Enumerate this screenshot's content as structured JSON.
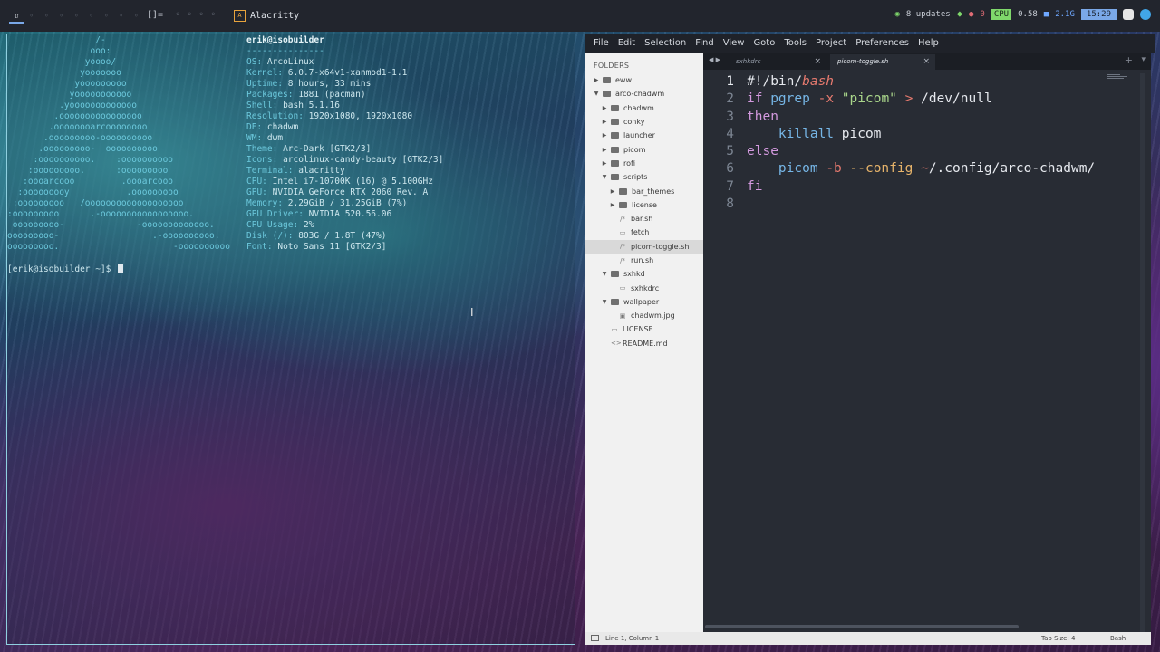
{
  "topbar": {
    "tags": [
      "ᴜ",
      "◦",
      "◦",
      "◦",
      "◦",
      "◦",
      "◦",
      "◦",
      "◦"
    ],
    "layout_symbol": "[]=",
    "layout_extras": [
      "◦",
      "◦",
      "◦",
      "◦"
    ],
    "window_icon": "A",
    "window_title": "Alacritty",
    "updates": "8 updates",
    "alerts": "0",
    "cpu_label": "CPU",
    "cpu_value": "0.58",
    "ram_value": "2.1G",
    "clock": "15:29"
  },
  "terminal": {
    "ascii_art": "                 /-\n                ooo:\n               yoooo/\n              yooooooo\n             yooooooooo\n            yooooooooooo\n          .yooooooooooooo\n         .oooooooooooooooo\n        .oooooooarcoooooooo\n       .ooooooooo-oooooooooo\n      .ooooooooo-  oooooooooo\n     :oooooooooo.    :oooooooooo\n    :ooooooooo.      :ooooooooo\n   :oooarcooo         .oooarcooo\n  :ooooooooy           .ooooooooo\n :ooooooooo   /ooooooooooooooooooo\n:ooooooooo      .-ooooooooooooooooo.\n ooooooooo-              -ooooooooooooo.\nooooooooo-                  .-oooooooooo.\nooooooooo.                      -oooooooooo",
    "user_host": "erik@isobuilder",
    "separator": "---------------",
    "info": [
      {
        "key": "OS",
        "value": "ArcoLinux"
      },
      {
        "key": "Kernel",
        "value": "6.0.7-x64v1-xanmod1-1.1"
      },
      {
        "key": "Uptime",
        "value": "8 hours, 33 mins"
      },
      {
        "key": "Packages",
        "value": "1881 (pacman)"
      },
      {
        "key": "Shell",
        "value": "bash 5.1.16"
      },
      {
        "key": "Resolution",
        "value": "1920x1080, 1920x1080"
      },
      {
        "key": "DE",
        "value": "chadwm"
      },
      {
        "key": "WM",
        "value": "dwm"
      },
      {
        "key": "Theme",
        "value": "Arc-Dark [GTK2/3]"
      },
      {
        "key": "Icons",
        "value": "arcolinux-candy-beauty [GTK2/3]"
      },
      {
        "key": "Terminal",
        "value": "alacritty"
      },
      {
        "key": "CPU",
        "value": "Intel i7-10700K (16) @ 5.100GHz"
      },
      {
        "key": "GPU",
        "value": "NVIDIA GeForce RTX 2060 Rev. A"
      },
      {
        "key": "Memory",
        "value": "2.29GiB / 31.25GiB (7%)"
      },
      {
        "key": "GPU Driver",
        "value": "NVIDIA 520.56.06"
      },
      {
        "key": "CPU Usage",
        "value": "2%"
      },
      {
        "key": "Disk (/)",
        "value": "803G / 1.8T (47%)"
      },
      {
        "key": "Font",
        "value": "Noto Sans 11 [GTK2/3]"
      }
    ],
    "prompt": "[erik@isobuilder ~]$ "
  },
  "editor": {
    "menu": [
      "File",
      "Edit",
      "Selection",
      "Find",
      "View",
      "Goto",
      "Tools",
      "Project",
      "Preferences",
      "Help"
    ],
    "folders_header": "FOLDERS",
    "tree": [
      {
        "label": "eww",
        "type": "folder",
        "depth": 0,
        "arrow": "▶"
      },
      {
        "label": "arco-chadwm",
        "type": "folder",
        "depth": 0,
        "arrow": "▼"
      },
      {
        "label": "chadwm",
        "type": "folder",
        "depth": 1,
        "arrow": "▶"
      },
      {
        "label": "conky",
        "type": "folder",
        "depth": 1,
        "arrow": "▶"
      },
      {
        "label": "launcher",
        "type": "folder",
        "depth": 1,
        "arrow": "▶"
      },
      {
        "label": "picom",
        "type": "folder",
        "depth": 1,
        "arrow": "▶"
      },
      {
        "label": "rofi",
        "type": "folder",
        "depth": 1,
        "arrow": "▶"
      },
      {
        "label": "scripts",
        "type": "folder",
        "depth": 1,
        "arrow": "▼"
      },
      {
        "label": "bar_themes",
        "type": "folder",
        "depth": 2,
        "arrow": "▶"
      },
      {
        "label": "license",
        "type": "folder",
        "depth": 2,
        "arrow": "▶"
      },
      {
        "label": "bar.sh",
        "type": "file",
        "depth": 2,
        "icon": "/*"
      },
      {
        "label": "fetch",
        "type": "file",
        "depth": 2,
        "icon": "▭"
      },
      {
        "label": "picom-toggle.sh",
        "type": "file",
        "depth": 2,
        "icon": "/*",
        "selected": true
      },
      {
        "label": "run.sh",
        "type": "file",
        "depth": 2,
        "icon": "/*"
      },
      {
        "label": "sxhkd",
        "type": "folder",
        "depth": 1,
        "arrow": "▼"
      },
      {
        "label": "sxhkdrc",
        "type": "file",
        "depth": 2,
        "icon": "▭"
      },
      {
        "label": "wallpaper",
        "type": "folder",
        "depth": 1,
        "arrow": "▼"
      },
      {
        "label": "chadwm.jpg",
        "type": "file",
        "depth": 2,
        "icon": "▣"
      },
      {
        "label": "LICENSE",
        "type": "file",
        "depth": 1,
        "icon": "▭"
      },
      {
        "label": "README.md",
        "type": "file",
        "depth": 1,
        "icon": "<>"
      }
    ],
    "tab_nav": "◀ ▶",
    "tabs": [
      {
        "label": "sxhkdrc",
        "active": false
      },
      {
        "label": "picom-toggle.sh",
        "active": true
      }
    ],
    "tab_close": "×",
    "tab_plus": "+",
    "tab_overflow": "▾",
    "code_lines": [
      {
        "n": "1",
        "current": true,
        "tokens": [
          [
            "txt",
            "#!/bin/"
          ],
          [
            "it",
            "bash"
          ]
        ]
      },
      {
        "n": "2",
        "tokens": [
          [
            "kw",
            "if "
          ],
          [
            "cmd",
            "pgrep "
          ],
          [
            "flag",
            "-x "
          ],
          [
            "str",
            "\"picom\""
          ],
          [
            "txt",
            " "
          ],
          [
            "op",
            ">"
          ],
          [
            "txt",
            " /dev/null"
          ]
        ]
      },
      {
        "n": "3",
        "tokens": [
          [
            "kw",
            "then"
          ]
        ]
      },
      {
        "n": "4",
        "tokens": [
          [
            "txt",
            "    "
          ],
          [
            "cmd",
            "killall"
          ],
          [
            "txt",
            " picom"
          ]
        ]
      },
      {
        "n": "5",
        "tokens": [
          [
            "kw",
            "else"
          ]
        ]
      },
      {
        "n": "6",
        "tokens": [
          [
            "txt",
            "    "
          ],
          [
            "cmd",
            "picom "
          ],
          [
            "flag",
            "-b "
          ],
          [
            "cfg",
            "--config "
          ],
          [
            "op",
            "~"
          ],
          [
            "txt",
            "/.config/arco-chadwm/"
          ]
        ]
      },
      {
        "n": "7",
        "tokens": [
          [
            "kw",
            "fi"
          ]
        ]
      },
      {
        "n": "8",
        "tokens": []
      }
    ],
    "status": {
      "position": "Line 1, Column 1",
      "tab_size": "Tab Size: 4",
      "syntax": "Bash"
    }
  }
}
